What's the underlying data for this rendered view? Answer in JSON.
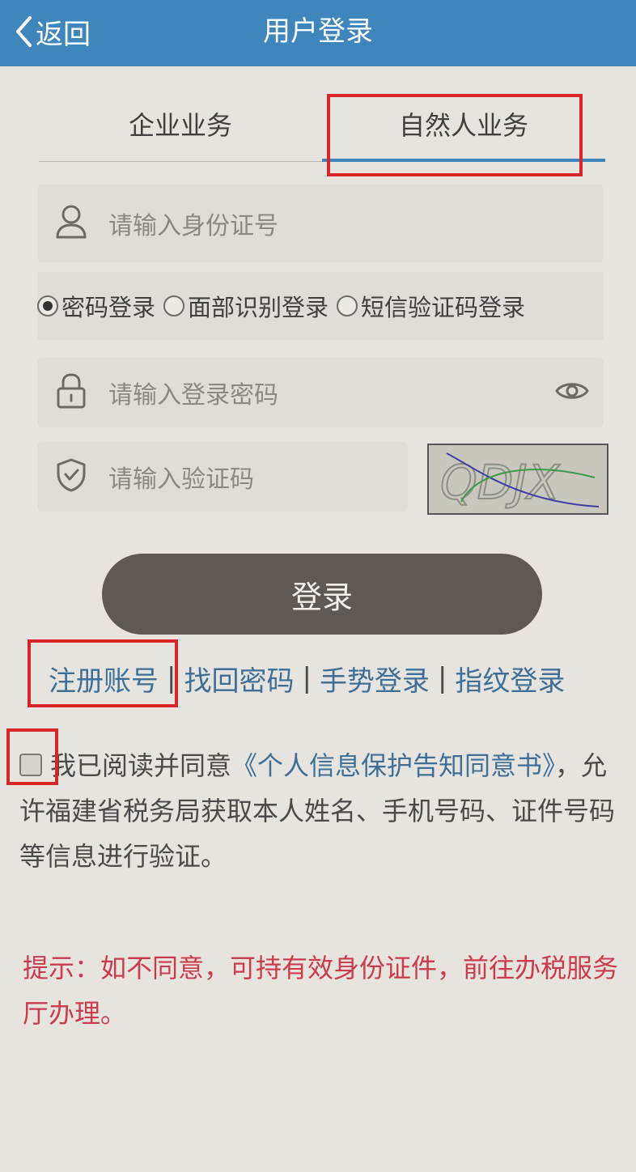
{
  "header": {
    "back_label": "返回",
    "title": "用户登录",
    "bg_color": "#3f86bd"
  },
  "tabs": [
    {
      "label": "企业业务",
      "active": false
    },
    {
      "label": "自然人业务",
      "active": true
    }
  ],
  "id_input": {
    "placeholder": "请输入身份证号",
    "icon": "user-icon"
  },
  "login_modes": [
    {
      "label": "密码登录",
      "selected": true
    },
    {
      "label": "面部识别登录",
      "selected": false
    },
    {
      "label": "短信验证码登录",
      "selected": false
    }
  ],
  "password_input": {
    "placeholder": "请输入登录密码",
    "icon": "lock-icon",
    "toggle_icon": "eye-icon"
  },
  "captcha_input": {
    "placeholder": "请输入验证码",
    "icon": "shield-icon"
  },
  "captcha_image": {
    "text": "QDJX"
  },
  "login_button": {
    "label": "登录"
  },
  "links": {
    "register": "注册账号",
    "separator": "|",
    "recover": "找回密码",
    "gesture": "手势登录",
    "fingerprint": "指纹登录"
  },
  "agreement": {
    "prefix": "我已阅读并同意",
    "document": "《个人信息保护告知同意书》",
    "suffix": "，允许福建省税务局获取本人姓名、手机号码、证件号码等信息进行验证。"
  },
  "hint": {
    "text": "提示：如不同意，可持有效身份证件，前往办税服务厅办理。",
    "color": "#cc3b4a"
  }
}
